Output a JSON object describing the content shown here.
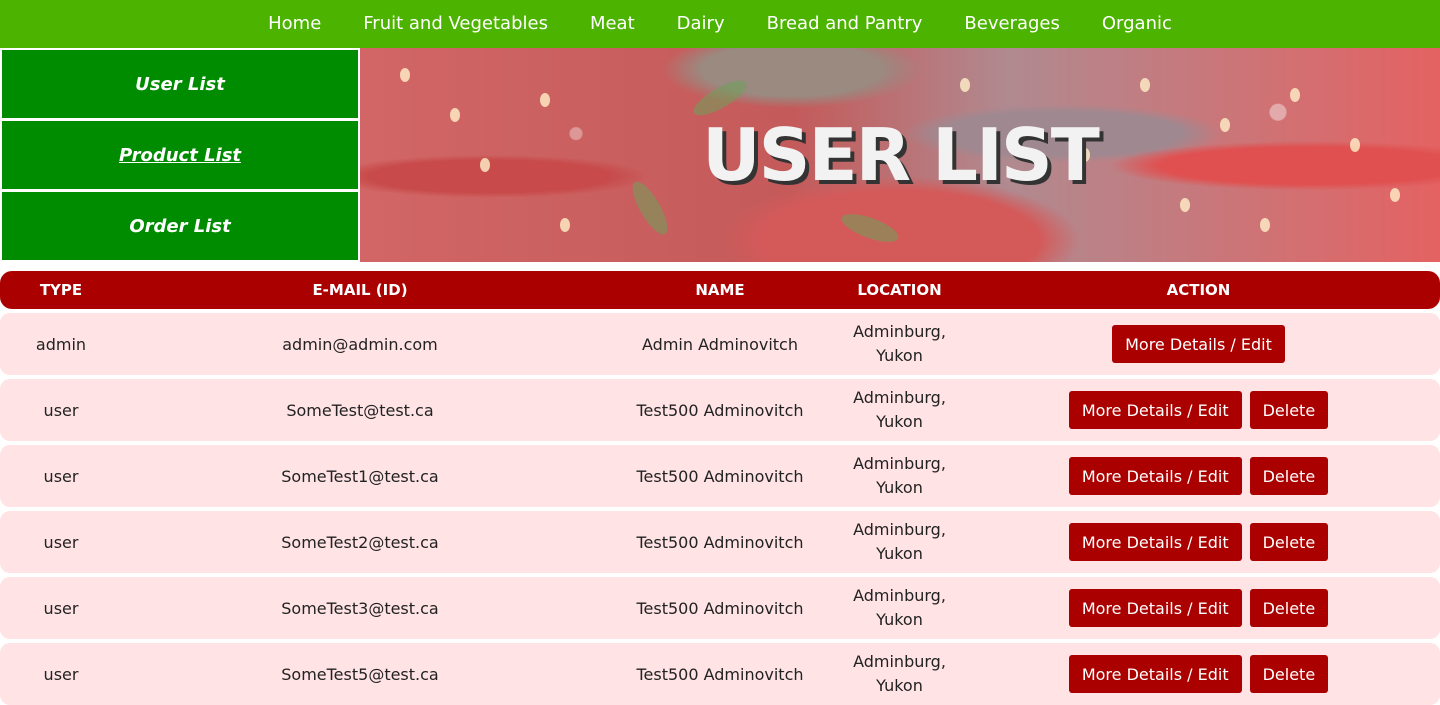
{
  "nav": {
    "items": [
      "Home",
      "Fruit and Vegetables",
      "Meat",
      "Dairy",
      "Bread and Pantry",
      "Beverages",
      "Organic"
    ]
  },
  "admin_menu": {
    "items": [
      "User List",
      "Product List",
      "Order List"
    ],
    "underlined_item": "Product List"
  },
  "banner": {
    "title": "USER LIST"
  },
  "table": {
    "headers": [
      "TYPE",
      "E-MAIL (ID)",
      "NAME",
      "LOCATION",
      "ACTION"
    ],
    "rows": [
      {
        "type": "admin",
        "email": "admin@admin.com",
        "name": "Admin Adminovitch",
        "location_line1": "Adminburg,",
        "location_line2": "Yukon",
        "edit_label": "More Details / Edit",
        "delete_label": null
      },
      {
        "type": "user",
        "email": "SomeTest@test.ca",
        "name": "Test500 Adminovitch",
        "location_line1": "Adminburg,",
        "location_line2": "Yukon",
        "edit_label": "More Details / Edit",
        "delete_label": "Delete"
      },
      {
        "type": "user",
        "email": "SomeTest1@test.ca",
        "name": "Test500 Adminovitch",
        "location_line1": "Adminburg,",
        "location_line2": "Yukon",
        "edit_label": "More Details / Edit",
        "delete_label": "Delete"
      },
      {
        "type": "user",
        "email": "SomeTest2@test.ca",
        "name": "Test500 Adminovitch",
        "location_line1": "Adminburg,",
        "location_line2": "Yukon",
        "edit_label": "More Details / Edit",
        "delete_label": "Delete"
      },
      {
        "type": "user",
        "email": "SomeTest3@test.ca",
        "name": "Test500 Adminovitch",
        "location_line1": "Adminburg,",
        "location_line2": "Yukon",
        "edit_label": "More Details / Edit",
        "delete_label": "Delete"
      },
      {
        "type": "user",
        "email": "SomeTest5@test.ca",
        "name": "Test500 Adminovitch",
        "location_line1": "Adminburg,",
        "location_line2": "Yukon",
        "edit_label": "More Details / Edit",
        "delete_label": "Delete"
      }
    ]
  },
  "colors": {
    "nav_bg": "#4cb400",
    "menu_bg": "#008c00",
    "header_bg": "#aa0000",
    "row_bg": "#ffe3e5",
    "button_bg": "#aa0000"
  }
}
